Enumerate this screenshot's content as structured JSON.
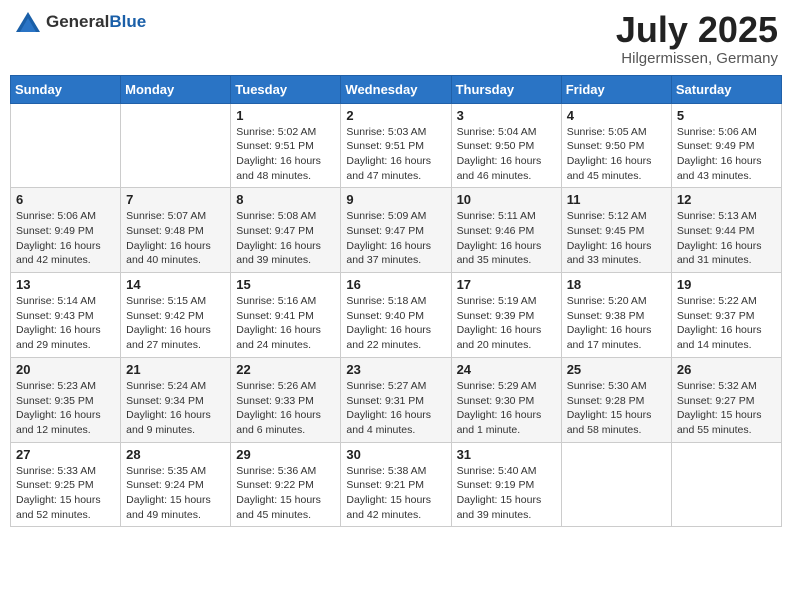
{
  "logo": {
    "general": "General",
    "blue": "Blue"
  },
  "header": {
    "month": "July 2025",
    "location": "Hilgermissen, Germany"
  },
  "weekdays": [
    "Sunday",
    "Monday",
    "Tuesday",
    "Wednesday",
    "Thursday",
    "Friday",
    "Saturday"
  ],
  "weeks": [
    [
      {
        "day": null
      },
      {
        "day": null
      },
      {
        "day": "1",
        "sunrise": "Sunrise: 5:02 AM",
        "sunset": "Sunset: 9:51 PM",
        "daylight": "Daylight: 16 hours and 48 minutes."
      },
      {
        "day": "2",
        "sunrise": "Sunrise: 5:03 AM",
        "sunset": "Sunset: 9:51 PM",
        "daylight": "Daylight: 16 hours and 47 minutes."
      },
      {
        "day": "3",
        "sunrise": "Sunrise: 5:04 AM",
        "sunset": "Sunset: 9:50 PM",
        "daylight": "Daylight: 16 hours and 46 minutes."
      },
      {
        "day": "4",
        "sunrise": "Sunrise: 5:05 AM",
        "sunset": "Sunset: 9:50 PM",
        "daylight": "Daylight: 16 hours and 45 minutes."
      },
      {
        "day": "5",
        "sunrise": "Sunrise: 5:06 AM",
        "sunset": "Sunset: 9:49 PM",
        "daylight": "Daylight: 16 hours and 43 minutes."
      }
    ],
    [
      {
        "day": "6",
        "sunrise": "Sunrise: 5:06 AM",
        "sunset": "Sunset: 9:49 PM",
        "daylight": "Daylight: 16 hours and 42 minutes."
      },
      {
        "day": "7",
        "sunrise": "Sunrise: 5:07 AM",
        "sunset": "Sunset: 9:48 PM",
        "daylight": "Daylight: 16 hours and 40 minutes."
      },
      {
        "day": "8",
        "sunrise": "Sunrise: 5:08 AM",
        "sunset": "Sunset: 9:47 PM",
        "daylight": "Daylight: 16 hours and 39 minutes."
      },
      {
        "day": "9",
        "sunrise": "Sunrise: 5:09 AM",
        "sunset": "Sunset: 9:47 PM",
        "daylight": "Daylight: 16 hours and 37 minutes."
      },
      {
        "day": "10",
        "sunrise": "Sunrise: 5:11 AM",
        "sunset": "Sunset: 9:46 PM",
        "daylight": "Daylight: 16 hours and 35 minutes."
      },
      {
        "day": "11",
        "sunrise": "Sunrise: 5:12 AM",
        "sunset": "Sunset: 9:45 PM",
        "daylight": "Daylight: 16 hours and 33 minutes."
      },
      {
        "day": "12",
        "sunrise": "Sunrise: 5:13 AM",
        "sunset": "Sunset: 9:44 PM",
        "daylight": "Daylight: 16 hours and 31 minutes."
      }
    ],
    [
      {
        "day": "13",
        "sunrise": "Sunrise: 5:14 AM",
        "sunset": "Sunset: 9:43 PM",
        "daylight": "Daylight: 16 hours and 29 minutes."
      },
      {
        "day": "14",
        "sunrise": "Sunrise: 5:15 AM",
        "sunset": "Sunset: 9:42 PM",
        "daylight": "Daylight: 16 hours and 27 minutes."
      },
      {
        "day": "15",
        "sunrise": "Sunrise: 5:16 AM",
        "sunset": "Sunset: 9:41 PM",
        "daylight": "Daylight: 16 hours and 24 minutes."
      },
      {
        "day": "16",
        "sunrise": "Sunrise: 5:18 AM",
        "sunset": "Sunset: 9:40 PM",
        "daylight": "Daylight: 16 hours and 22 minutes."
      },
      {
        "day": "17",
        "sunrise": "Sunrise: 5:19 AM",
        "sunset": "Sunset: 9:39 PM",
        "daylight": "Daylight: 16 hours and 20 minutes."
      },
      {
        "day": "18",
        "sunrise": "Sunrise: 5:20 AM",
        "sunset": "Sunset: 9:38 PM",
        "daylight": "Daylight: 16 hours and 17 minutes."
      },
      {
        "day": "19",
        "sunrise": "Sunrise: 5:22 AM",
        "sunset": "Sunset: 9:37 PM",
        "daylight": "Daylight: 16 hours and 14 minutes."
      }
    ],
    [
      {
        "day": "20",
        "sunrise": "Sunrise: 5:23 AM",
        "sunset": "Sunset: 9:35 PM",
        "daylight": "Daylight: 16 hours and 12 minutes."
      },
      {
        "day": "21",
        "sunrise": "Sunrise: 5:24 AM",
        "sunset": "Sunset: 9:34 PM",
        "daylight": "Daylight: 16 hours and 9 minutes."
      },
      {
        "day": "22",
        "sunrise": "Sunrise: 5:26 AM",
        "sunset": "Sunset: 9:33 PM",
        "daylight": "Daylight: 16 hours and 6 minutes."
      },
      {
        "day": "23",
        "sunrise": "Sunrise: 5:27 AM",
        "sunset": "Sunset: 9:31 PM",
        "daylight": "Daylight: 16 hours and 4 minutes."
      },
      {
        "day": "24",
        "sunrise": "Sunrise: 5:29 AM",
        "sunset": "Sunset: 9:30 PM",
        "daylight": "Daylight: 16 hours and 1 minute."
      },
      {
        "day": "25",
        "sunrise": "Sunrise: 5:30 AM",
        "sunset": "Sunset: 9:28 PM",
        "daylight": "Daylight: 15 hours and 58 minutes."
      },
      {
        "day": "26",
        "sunrise": "Sunrise: 5:32 AM",
        "sunset": "Sunset: 9:27 PM",
        "daylight": "Daylight: 15 hours and 55 minutes."
      }
    ],
    [
      {
        "day": "27",
        "sunrise": "Sunrise: 5:33 AM",
        "sunset": "Sunset: 9:25 PM",
        "daylight": "Daylight: 15 hours and 52 minutes."
      },
      {
        "day": "28",
        "sunrise": "Sunrise: 5:35 AM",
        "sunset": "Sunset: 9:24 PM",
        "daylight": "Daylight: 15 hours and 49 minutes."
      },
      {
        "day": "29",
        "sunrise": "Sunrise: 5:36 AM",
        "sunset": "Sunset: 9:22 PM",
        "daylight": "Daylight: 15 hours and 45 minutes."
      },
      {
        "day": "30",
        "sunrise": "Sunrise: 5:38 AM",
        "sunset": "Sunset: 9:21 PM",
        "daylight": "Daylight: 15 hours and 42 minutes."
      },
      {
        "day": "31",
        "sunrise": "Sunrise: 5:40 AM",
        "sunset": "Sunset: 9:19 PM",
        "daylight": "Daylight: 15 hours and 39 minutes."
      },
      {
        "day": null
      },
      {
        "day": null
      }
    ]
  ]
}
